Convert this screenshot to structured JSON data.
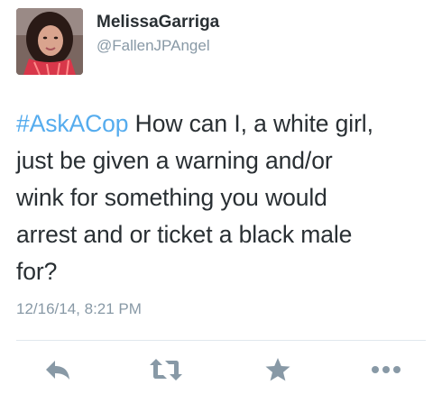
{
  "user": {
    "display_name": "MelissaGarriga",
    "handle": "@FallenJPAngel",
    "avatar_icon": "profile-photo"
  },
  "tweet": {
    "hashtag": "#AskACop",
    "lines": [
      " How can I, a white girl,",
      "just be given a warning and/or",
      "wink for something you would",
      "arrest and or ticket a black male",
      "for?"
    ],
    "timestamp": "12/16/14, 8:21 PM"
  },
  "actions": {
    "reply_icon": "reply-icon",
    "retweet_icon": "retweet-icon",
    "favorite_icon": "star-icon",
    "more_icon": "more-icon"
  },
  "colors": {
    "link": "#55acee",
    "text": "#292f33",
    "muted": "#8899a6",
    "action_icon": "#8899a6",
    "divider": "#e1e8ed"
  }
}
